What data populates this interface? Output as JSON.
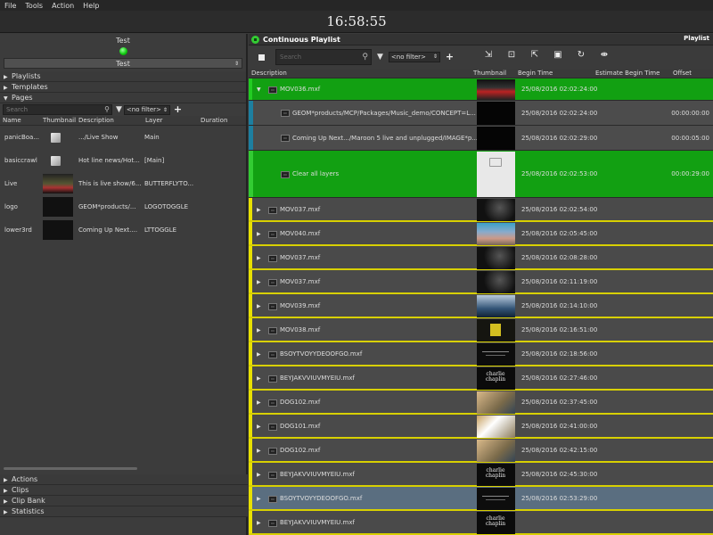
{
  "menu": [
    "File",
    "Tools",
    "Action",
    "Help"
  ],
  "clock": "16:58:55",
  "left": {
    "channel_title": "Test",
    "channel_select": "Test",
    "sections_top": [
      "Playlists",
      "Templates"
    ],
    "pages_label": "Pages",
    "search_placeholder": "Search",
    "filter": "<no filter>",
    "columns": [
      "Name",
      "Thumbnail",
      "Description",
      "Layer",
      "Duration"
    ],
    "rows": [
      {
        "name": "panicBoa...",
        "thumb": "cube",
        "desc": ".../Live Show",
        "layer": "Main"
      },
      {
        "name": "basiccrawl",
        "thumb": "cube",
        "desc": "Hot line news/Hot...",
        "layer": "[Main]"
      },
      {
        "name": "Live",
        "thumb": "live",
        "desc": "This is live show/6...",
        "layer": "BUTTERFLYTO..."
      },
      {
        "name": "logo",
        "thumb": "dark",
        "desc": "GEOM*products/...",
        "layer": "LOGOTOGGLE"
      },
      {
        "name": "lower3rd",
        "thumb": "dark",
        "desc": "Coming Up Next....",
        "layer": "LTTOGGLE"
      }
    ],
    "sections_bottom": [
      "Actions",
      "Clips",
      "Clip Bank",
      "Statistics"
    ]
  },
  "right": {
    "title": "Continuous Playlist",
    "corner": "Playlist",
    "search_placeholder": "Search",
    "filter": "<no filter>",
    "columns": [
      "Description",
      "Thumbnail",
      "Begin Time",
      "Estimate Begin Time",
      "Offset"
    ],
    "rows": [
      {
        "kind": "green",
        "tri": "▼",
        "desc": "MOV036.mxf",
        "begin": "25/08/2016 02:02:24:00",
        "offset": "",
        "thumb": "news"
      },
      {
        "kind": "child",
        "desc": "GEOM*products/MCP/Packages/Music_demo/CONCEPT=L...",
        "begin": "25/08/2016 02:02:24:00",
        "offset": "00:00:00:00",
        "thumb": "black"
      },
      {
        "kind": "child",
        "desc": "Coming Up Next.../Maroon 5 live and unplugged/IMAGE*p...",
        "begin": "25/08/2016 02:02:29:00",
        "offset": "00:00:05:00",
        "thumb": "black"
      },
      {
        "kind": "childgreen",
        "desc": "Clear all layers",
        "begin": "25/08/2016 02:02:53:00",
        "offset": "00:00:29:00",
        "thumb": "cast"
      },
      {
        "kind": "normal",
        "tri": "▶",
        "desc": "MOV037.mxf",
        "begin": "25/08/2016 02:02:54:00",
        "thumb": "dark"
      },
      {
        "kind": "normal",
        "tri": "▶",
        "desc": "MOV040.mxf",
        "begin": "25/08/2016 02:05:45:00",
        "thumb": "crowd"
      },
      {
        "kind": "normal",
        "tri": "▶",
        "desc": "MOV037.mxf",
        "begin": "25/08/2016 02:08:28:00",
        "thumb": "dark"
      },
      {
        "kind": "normal",
        "tri": "▶",
        "desc": "MOV037.mxf",
        "begin": "25/08/2016 02:11:19:00",
        "thumb": "dark"
      },
      {
        "kind": "normal",
        "tri": "▶",
        "desc": "MOV039.mxf",
        "begin": "25/08/2016 02:14:10:00",
        "thumb": "sky"
      },
      {
        "kind": "normal",
        "tri": "▶",
        "desc": "MOV038.mxf",
        "begin": "25/08/2016 02:16:51:00",
        "thumb": "yellowlogo"
      },
      {
        "kind": "normal",
        "tri": "▶",
        "desc": "BSOYTVOYYDEOOFGO.mxf",
        "begin": "25/08/2016 02:18:56:00",
        "thumb": "textblack"
      },
      {
        "kind": "normal",
        "tri": "▶",
        "desc": "BEYJAKVVIUVMYEIU.mxf",
        "begin": "25/08/2016 02:27:46:00",
        "thumb": "charlie"
      },
      {
        "kind": "normal",
        "tri": "▶",
        "desc": "DOG102.mxf",
        "begin": "25/08/2016 02:37:45:00",
        "thumb": "dog"
      },
      {
        "kind": "normal",
        "tri": "▶",
        "desc": "DOG101.mxf",
        "begin": "25/08/2016 02:41:00:00",
        "thumb": "dog2"
      },
      {
        "kind": "normal",
        "tri": "▶",
        "desc": "DOG102.mxf",
        "begin": "25/08/2016 02:42:15:00",
        "thumb": "dog"
      },
      {
        "kind": "normal",
        "tri": "▶",
        "desc": "BEYJAKVVIUVMYEIU.mxf",
        "begin": "25/08/2016 02:45:30:00",
        "thumb": "charlie"
      },
      {
        "kind": "selected",
        "tri": "▶",
        "desc": "BSOYTVOYYDEOOFGO.mxf",
        "begin": "25/08/2016 02:53:29:00",
        "thumb": "textblack"
      },
      {
        "kind": "normal",
        "tri": "▶",
        "desc": "BEYJAKVVIUVMYEIU.mxf",
        "begin": "",
        "thumb": "charlie"
      }
    ]
  }
}
